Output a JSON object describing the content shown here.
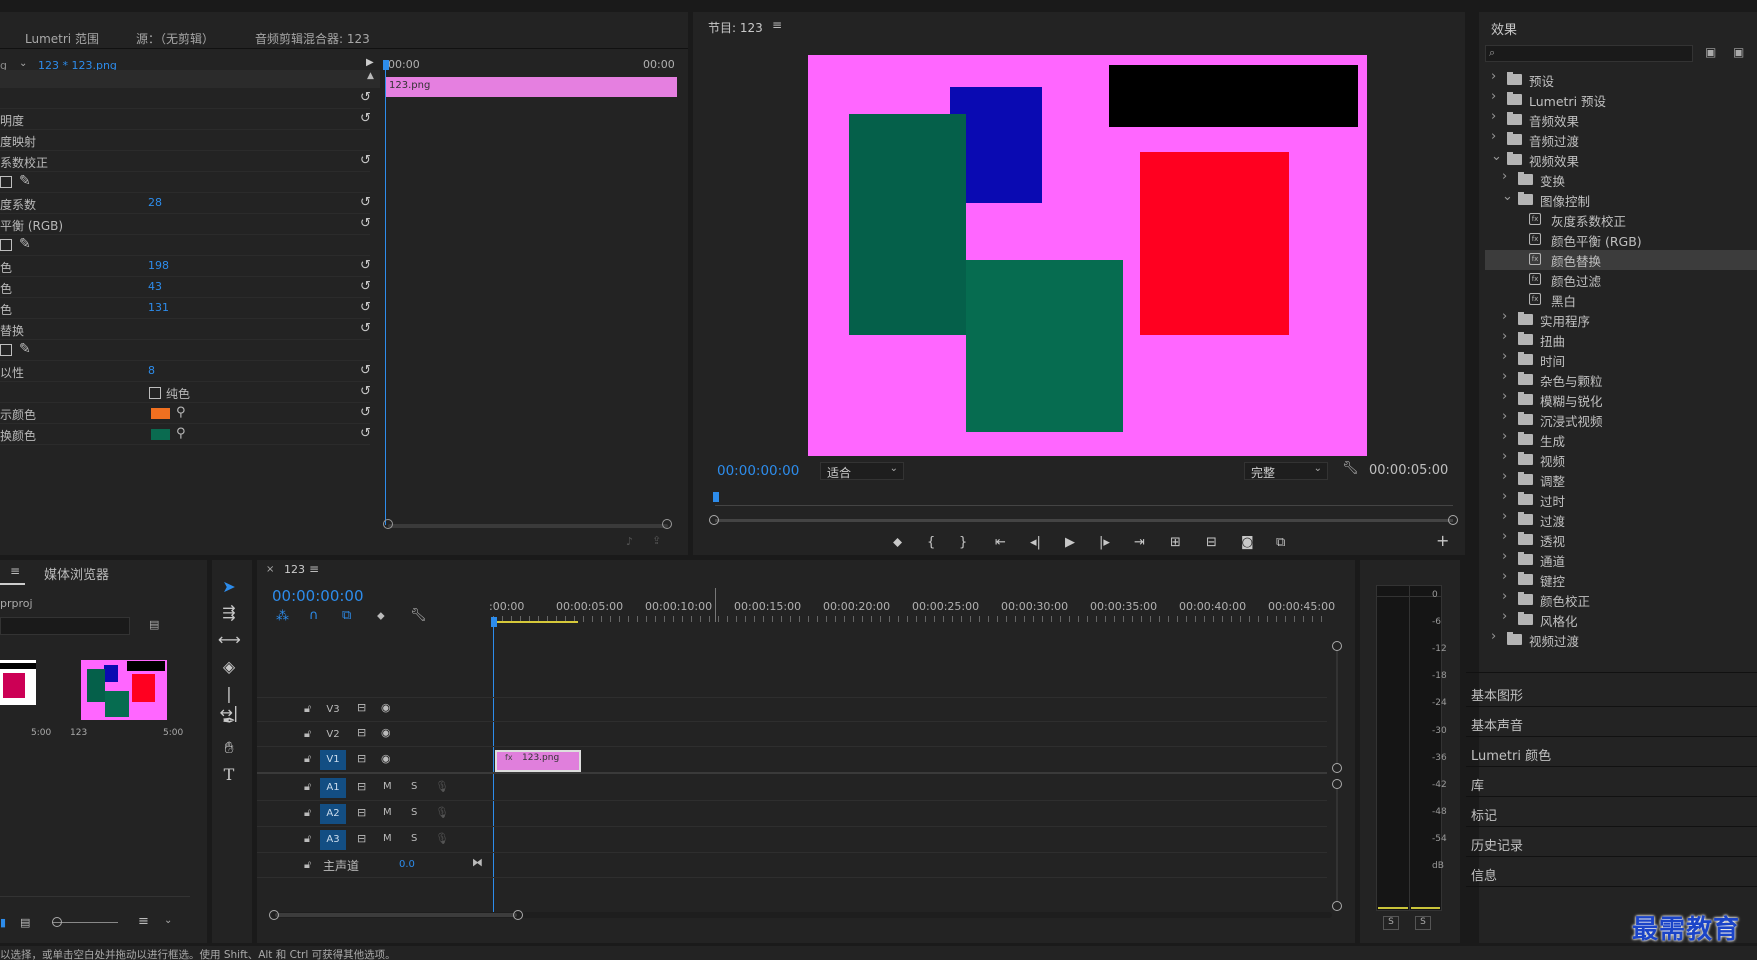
{
  "top_tabs": {
    "lumetri_scopes": "Lumetri 范围",
    "source": "源：（无剪辑）",
    "audio_mixer": "音频剪辑混合器: 123"
  },
  "effect_controls": {
    "master": "g",
    "clip_path": "123 * 123.png",
    "timecode_start": "00:00",
    "timecode_end": "00:00",
    "clip_label": "123.png",
    "rows": [
      {
        "label": "",
        "value": ""
      },
      {
        "label": "明度",
        "value": ""
      },
      {
        "label": "度映射",
        "value": ""
      },
      {
        "label": "系数校正",
        "value": ""
      },
      {
        "label": "",
        "value": ""
      },
      {
        "label": "度系数",
        "value": "28"
      },
      {
        "label": "平衡 (RGB)",
        "value": ""
      },
      {
        "label": "",
        "value": ""
      },
      {
        "label": "色",
        "value": "198"
      },
      {
        "label": "色",
        "value": "43"
      },
      {
        "label": "色",
        "value": "131"
      },
      {
        "label": "替换",
        "value": ""
      },
      {
        "label": "",
        "value": ""
      },
      {
        "label": "以性",
        "value": "8"
      },
      {
        "label": "",
        "value": ""
      },
      {
        "label": "示颜色",
        "value": ""
      },
      {
        "label": "换颜色",
        "value": ""
      }
    ],
    "solid_label": "纯色",
    "target_color": "#f07020",
    "replace_color": "#0a6b50"
  },
  "program": {
    "title": "节目: 123",
    "timecode": "00:00:00:00",
    "fit": "适合",
    "quality": "完整",
    "duration": "00:00:05:00",
    "bg": "#ff66ff"
  },
  "effects_panel": {
    "title": "效果",
    "search_placeholder": "",
    "items": [
      {
        "label": "预设",
        "level": 0,
        "kind": "preset",
        "open": false
      },
      {
        "label": "Lumetri 预设",
        "level": 0,
        "kind": "preset",
        "open": false
      },
      {
        "label": "音频效果",
        "level": 0,
        "kind": "folder",
        "open": false
      },
      {
        "label": "音频过渡",
        "level": 0,
        "kind": "folder",
        "open": false
      },
      {
        "label": "视频效果",
        "level": 0,
        "kind": "folder",
        "open": true
      },
      {
        "label": "变换",
        "level": 1,
        "kind": "folder",
        "open": false
      },
      {
        "label": "图像控制",
        "level": 1,
        "kind": "folder",
        "open": true
      },
      {
        "label": "灰度系数校正",
        "level": 2,
        "kind": "fx"
      },
      {
        "label": "颜色平衡 (RGB)",
        "level": 2,
        "kind": "fx"
      },
      {
        "label": "颜色替换",
        "level": 2,
        "kind": "fx",
        "selected": true
      },
      {
        "label": "颜色过滤",
        "level": 2,
        "kind": "fx"
      },
      {
        "label": "黑白",
        "level": 2,
        "kind": "fx"
      },
      {
        "label": "实用程序",
        "level": 1,
        "kind": "folder",
        "open": false
      },
      {
        "label": "扭曲",
        "level": 1,
        "kind": "folder",
        "open": false
      },
      {
        "label": "时间",
        "level": 1,
        "kind": "folder",
        "open": false
      },
      {
        "label": "杂色与颗粒",
        "level": 1,
        "kind": "folder",
        "open": false
      },
      {
        "label": "模糊与锐化",
        "level": 1,
        "kind": "folder",
        "open": false
      },
      {
        "label": "沉浸式视频",
        "level": 1,
        "kind": "folder",
        "open": false
      },
      {
        "label": "生成",
        "level": 1,
        "kind": "folder",
        "open": false
      },
      {
        "label": "视频",
        "level": 1,
        "kind": "folder",
        "open": false
      },
      {
        "label": "调整",
        "level": 1,
        "kind": "folder",
        "open": false
      },
      {
        "label": "过时",
        "level": 1,
        "kind": "folder",
        "open": false
      },
      {
        "label": "过渡",
        "level": 1,
        "kind": "folder",
        "open": false
      },
      {
        "label": "透视",
        "level": 1,
        "kind": "folder",
        "open": false
      },
      {
        "label": "通道",
        "level": 1,
        "kind": "folder",
        "open": false
      },
      {
        "label": "键控",
        "level": 1,
        "kind": "folder",
        "open": false
      },
      {
        "label": "颜色校正",
        "level": 1,
        "kind": "folder",
        "open": false
      },
      {
        "label": "风格化",
        "level": 1,
        "kind": "folder",
        "open": false
      },
      {
        "label": "视频过渡",
        "level": 0,
        "kind": "folder",
        "open": false
      }
    ],
    "sections": [
      "基本图形",
      "基本声音",
      "Lumetri 颜色",
      "库",
      "标记",
      "历史记录",
      "信息"
    ]
  },
  "project": {
    "tab_media_browser": "媒体浏览器",
    "project_file": "prproj",
    "items": [
      {
        "name": "",
        "duration": "5:00"
      },
      {
        "name": "123",
        "duration": "5:00"
      }
    ]
  },
  "timeline": {
    "tab": "123",
    "timecode": "00:00:00:00",
    "ruler": [
      ":00:00",
      "00:00:05:00",
      "00:00:10:00",
      "00:00:15:00",
      "00:00:20:00",
      "00:00:25:00",
      "00:00:30:00",
      "00:00:35:00",
      "00:00:40:00",
      "00:00:45:00"
    ],
    "video_tracks": [
      "V3",
      "V2",
      "V1"
    ],
    "audio_tracks": [
      "A1",
      "A2",
      "A3"
    ],
    "master": "主声道",
    "master_value": "0.0",
    "clip": "123.png",
    "mute": "M",
    "solo": "S"
  },
  "meter": {
    "scale": [
      "0",
      "-6",
      "-12",
      "-18",
      "-24",
      "-30",
      "-36",
      "-42",
      "-48",
      "-54",
      "dB"
    ],
    "solo": [
      "S",
      "S"
    ]
  },
  "status_bar": "以选择，或单击空白处并拖动以进行框选。使用 Shift、Alt 和 Ctrl 可获得其他选项。",
  "watermark": "最需教育"
}
